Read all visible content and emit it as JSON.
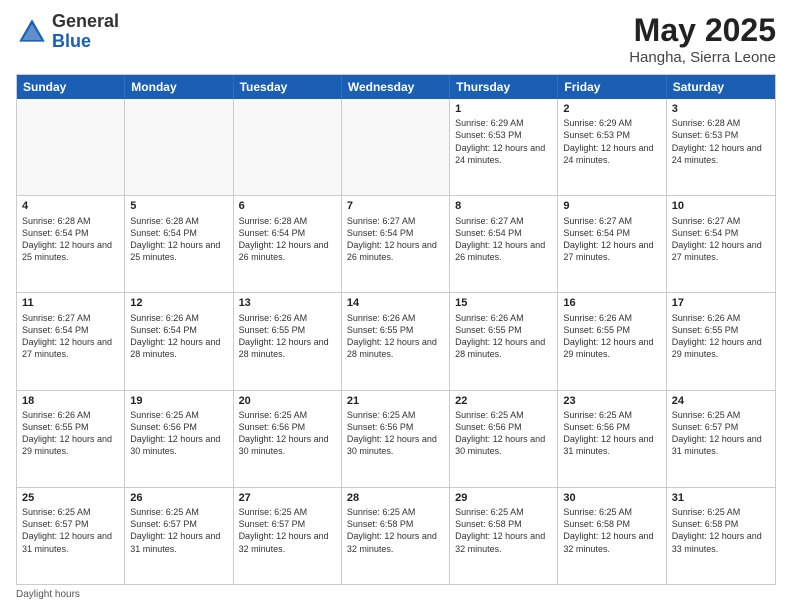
{
  "logo": {
    "general": "General",
    "blue": "Blue"
  },
  "title": {
    "month_year": "May 2025",
    "location": "Hangha, Sierra Leone"
  },
  "weekdays": [
    "Sunday",
    "Monday",
    "Tuesday",
    "Wednesday",
    "Thursday",
    "Friday",
    "Saturday"
  ],
  "weeks": [
    [
      {
        "day": "",
        "sunrise": "",
        "sunset": "",
        "daylight": ""
      },
      {
        "day": "",
        "sunrise": "",
        "sunset": "",
        "daylight": ""
      },
      {
        "day": "",
        "sunrise": "",
        "sunset": "",
        "daylight": ""
      },
      {
        "day": "",
        "sunrise": "",
        "sunset": "",
        "daylight": ""
      },
      {
        "day": "1",
        "sunrise": "Sunrise: 6:29 AM",
        "sunset": "Sunset: 6:53 PM",
        "daylight": "Daylight: 12 hours and 24 minutes."
      },
      {
        "day": "2",
        "sunrise": "Sunrise: 6:29 AM",
        "sunset": "Sunset: 6:53 PM",
        "daylight": "Daylight: 12 hours and 24 minutes."
      },
      {
        "day": "3",
        "sunrise": "Sunrise: 6:28 AM",
        "sunset": "Sunset: 6:53 PM",
        "daylight": "Daylight: 12 hours and 24 minutes."
      }
    ],
    [
      {
        "day": "4",
        "sunrise": "Sunrise: 6:28 AM",
        "sunset": "Sunset: 6:54 PM",
        "daylight": "Daylight: 12 hours and 25 minutes."
      },
      {
        "day": "5",
        "sunrise": "Sunrise: 6:28 AM",
        "sunset": "Sunset: 6:54 PM",
        "daylight": "Daylight: 12 hours and 25 minutes."
      },
      {
        "day": "6",
        "sunrise": "Sunrise: 6:28 AM",
        "sunset": "Sunset: 6:54 PM",
        "daylight": "Daylight: 12 hours and 26 minutes."
      },
      {
        "day": "7",
        "sunrise": "Sunrise: 6:27 AM",
        "sunset": "Sunset: 6:54 PM",
        "daylight": "Daylight: 12 hours and 26 minutes."
      },
      {
        "day": "8",
        "sunrise": "Sunrise: 6:27 AM",
        "sunset": "Sunset: 6:54 PM",
        "daylight": "Daylight: 12 hours and 26 minutes."
      },
      {
        "day": "9",
        "sunrise": "Sunrise: 6:27 AM",
        "sunset": "Sunset: 6:54 PM",
        "daylight": "Daylight: 12 hours and 27 minutes."
      },
      {
        "day": "10",
        "sunrise": "Sunrise: 6:27 AM",
        "sunset": "Sunset: 6:54 PM",
        "daylight": "Daylight: 12 hours and 27 minutes."
      }
    ],
    [
      {
        "day": "11",
        "sunrise": "Sunrise: 6:27 AM",
        "sunset": "Sunset: 6:54 PM",
        "daylight": "Daylight: 12 hours and 27 minutes."
      },
      {
        "day": "12",
        "sunrise": "Sunrise: 6:26 AM",
        "sunset": "Sunset: 6:54 PM",
        "daylight": "Daylight: 12 hours and 28 minutes."
      },
      {
        "day": "13",
        "sunrise": "Sunrise: 6:26 AM",
        "sunset": "Sunset: 6:55 PM",
        "daylight": "Daylight: 12 hours and 28 minutes."
      },
      {
        "day": "14",
        "sunrise": "Sunrise: 6:26 AM",
        "sunset": "Sunset: 6:55 PM",
        "daylight": "Daylight: 12 hours and 28 minutes."
      },
      {
        "day": "15",
        "sunrise": "Sunrise: 6:26 AM",
        "sunset": "Sunset: 6:55 PM",
        "daylight": "Daylight: 12 hours and 28 minutes."
      },
      {
        "day": "16",
        "sunrise": "Sunrise: 6:26 AM",
        "sunset": "Sunset: 6:55 PM",
        "daylight": "Daylight: 12 hours and 29 minutes."
      },
      {
        "day": "17",
        "sunrise": "Sunrise: 6:26 AM",
        "sunset": "Sunset: 6:55 PM",
        "daylight": "Daylight: 12 hours and 29 minutes."
      }
    ],
    [
      {
        "day": "18",
        "sunrise": "Sunrise: 6:26 AM",
        "sunset": "Sunset: 6:55 PM",
        "daylight": "Daylight: 12 hours and 29 minutes."
      },
      {
        "day": "19",
        "sunrise": "Sunrise: 6:25 AM",
        "sunset": "Sunset: 6:56 PM",
        "daylight": "Daylight: 12 hours and 30 minutes."
      },
      {
        "day": "20",
        "sunrise": "Sunrise: 6:25 AM",
        "sunset": "Sunset: 6:56 PM",
        "daylight": "Daylight: 12 hours and 30 minutes."
      },
      {
        "day": "21",
        "sunrise": "Sunrise: 6:25 AM",
        "sunset": "Sunset: 6:56 PM",
        "daylight": "Daylight: 12 hours and 30 minutes."
      },
      {
        "day": "22",
        "sunrise": "Sunrise: 6:25 AM",
        "sunset": "Sunset: 6:56 PM",
        "daylight": "Daylight: 12 hours and 30 minutes."
      },
      {
        "day": "23",
        "sunrise": "Sunrise: 6:25 AM",
        "sunset": "Sunset: 6:56 PM",
        "daylight": "Daylight: 12 hours and 31 minutes."
      },
      {
        "day": "24",
        "sunrise": "Sunrise: 6:25 AM",
        "sunset": "Sunset: 6:57 PM",
        "daylight": "Daylight: 12 hours and 31 minutes."
      }
    ],
    [
      {
        "day": "25",
        "sunrise": "Sunrise: 6:25 AM",
        "sunset": "Sunset: 6:57 PM",
        "daylight": "Daylight: 12 hours and 31 minutes."
      },
      {
        "day": "26",
        "sunrise": "Sunrise: 6:25 AM",
        "sunset": "Sunset: 6:57 PM",
        "daylight": "Daylight: 12 hours and 31 minutes."
      },
      {
        "day": "27",
        "sunrise": "Sunrise: 6:25 AM",
        "sunset": "Sunset: 6:57 PM",
        "daylight": "Daylight: 12 hours and 32 minutes."
      },
      {
        "day": "28",
        "sunrise": "Sunrise: 6:25 AM",
        "sunset": "Sunset: 6:58 PM",
        "daylight": "Daylight: 12 hours and 32 minutes."
      },
      {
        "day": "29",
        "sunrise": "Sunrise: 6:25 AM",
        "sunset": "Sunset: 6:58 PM",
        "daylight": "Daylight: 12 hours and 32 minutes."
      },
      {
        "day": "30",
        "sunrise": "Sunrise: 6:25 AM",
        "sunset": "Sunset: 6:58 PM",
        "daylight": "Daylight: 12 hours and 32 minutes."
      },
      {
        "day": "31",
        "sunrise": "Sunrise: 6:25 AM",
        "sunset": "Sunset: 6:58 PM",
        "daylight": "Daylight: 12 hours and 33 minutes."
      }
    ]
  ],
  "footer": {
    "note": "Daylight hours"
  }
}
